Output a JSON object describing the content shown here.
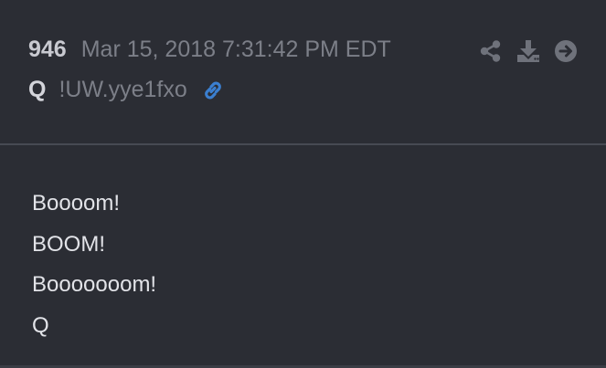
{
  "post": {
    "number": "946",
    "timestamp": "Mar 15, 2018 7:31:42 PM EDT",
    "author": "Q",
    "tripcode": "!UW.yye1fxo",
    "body_lines": [
      "Boooom!",
      "BOOM!",
      "Booooooom!",
      "Q"
    ]
  },
  "icons": {
    "link": "link-icon",
    "share": "share-icon",
    "download": "download-icon",
    "next": "arrow-right-circle-icon"
  },
  "colors": {
    "background": "#2b2d34",
    "link_accent": "#3b7fd0",
    "muted_text": "#7c7f88",
    "body_text": "#e2e3e8",
    "icon_gray": "#6f727b"
  }
}
